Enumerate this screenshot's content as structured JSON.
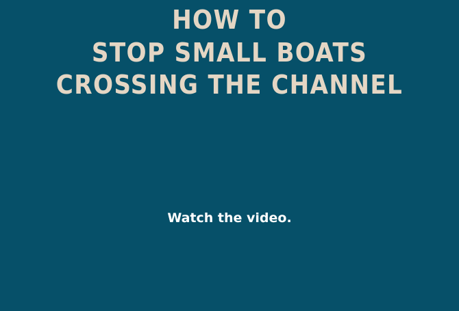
{
  "headline": {
    "line1": "HOW TO",
    "line2": "STOP SMALL BOATS",
    "line3": "CROSSING THE CHANNEL"
  },
  "cta": {
    "label": "Watch the video."
  },
  "colors": {
    "background": "#065069",
    "headline": "#e4d6c4",
    "cta": "#ffffff"
  }
}
